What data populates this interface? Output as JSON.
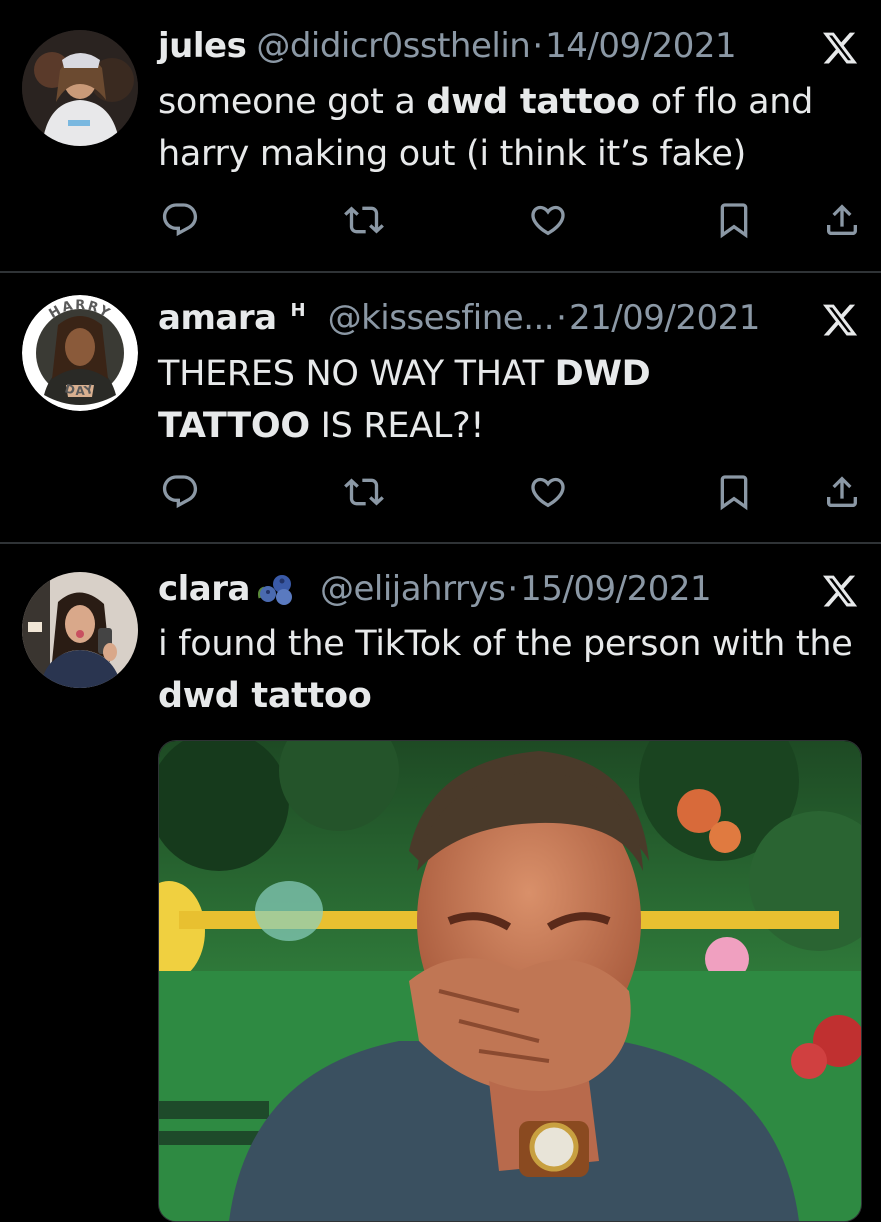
{
  "tweets": [
    {
      "name": "jules",
      "badge": "",
      "handle": "@didicr0ssthelin",
      "separator": "·",
      "date": "14/09/2021",
      "text_parts": [
        {
          "t": "someone got a ",
          "b": false
        },
        {
          "t": "dwd tattoo",
          "b": true
        },
        {
          "t": " of flo and harry making out (i think it’s fake)",
          "b": false
        }
      ]
    },
    {
      "name": "amara",
      "badge": "H",
      "handle": "@kissesfine...",
      "separator": "·",
      "date": "21/09/2021",
      "avatar_ring_top": "HARRY",
      "avatar_ring_bottom": "DAY",
      "text_parts": [
        {
          "t": "THERES NO WAY THAT ",
          "b": false
        },
        {
          "t": "DWD TATTOO",
          "b": true
        },
        {
          "t": " IS REAL?!",
          "b": false
        }
      ]
    },
    {
      "name": "clara",
      "badge": "blueberries-emoji",
      "handle": "@elijahrrys",
      "separator": "·",
      "date": "15/09/2021",
      "text_parts": [
        {
          "t": "i found the TikTok of the person with the ",
          "b": false
        },
        {
          "t": "dwd tattoo",
          "b": true
        }
      ],
      "media": "photo of man laughing and covering mouth with hand"
    }
  ],
  "icons": {
    "reply": "reply-icon",
    "retweet": "retweet-icon",
    "like": "heart-icon",
    "bookmark": "bookmark-icon",
    "share": "share-icon",
    "x": "x-logo-icon"
  },
  "colors": {
    "background": "#000000",
    "text": "#e7e9ea",
    "secondary": "#8b98a5",
    "divider": "#2f3336"
  }
}
